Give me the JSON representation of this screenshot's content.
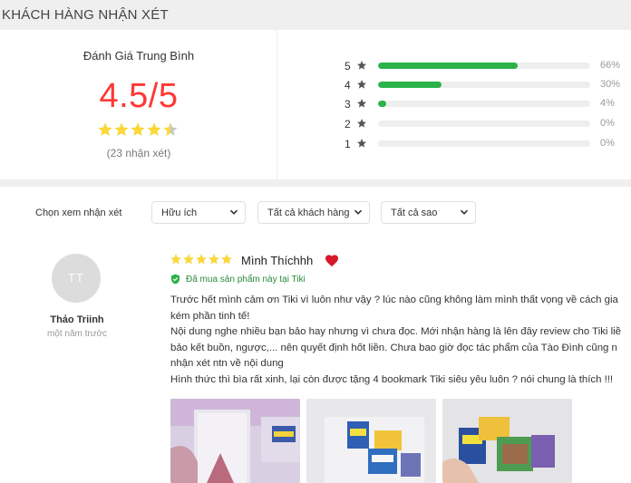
{
  "section_title": "KHÁCH HÀNG NHẬN XÉT",
  "summary": {
    "heading": "Đánh Giá Trung Bình",
    "score": "4.5/5",
    "rating": 4.5,
    "count": "(23 nhận xét)"
  },
  "distribution": [
    {
      "stars": "5",
      "percent_label": "66%",
      "percent": 66
    },
    {
      "stars": "4",
      "percent_label": "30%",
      "percent": 30
    },
    {
      "stars": "3",
      "percent_label": "4%",
      "percent": 4
    },
    {
      "stars": "2",
      "percent_label": "0%",
      "percent": 0
    },
    {
      "stars": "1",
      "percent_label": "0%",
      "percent": 0
    }
  ],
  "filters": {
    "label": "Chọn xem nhận xét",
    "sort": "Hữu ích",
    "customers": "Tất cả khách hàng",
    "stars": "Tất cả sao"
  },
  "review": {
    "avatar_initials": "TT",
    "author": "Thảo Triinh",
    "time": "một năm trước",
    "rating": 5,
    "title": "Mình Thíchhh",
    "verified": "Đã mua sản phẩm này tại Tiki",
    "lines": [
      "Trước hết mình cảm ơn Tiki vì luôn như vậy ? lúc nào cũng không làm mình thất vọng về cách gia",
      "kém phần tinh tế!",
      "Nội dung nghe nhiều bạn bảo hay nhưng vì chưa đọc. Mới nhận hàng là lên đây review cho Tiki liề",
      "bảo kết buồn, ngược,... nên quyết định hốt liền. Chưa bao giờ đọc tác phẩm của Tào Đình cũng n",
      "nhận xét ntn về nội dung",
      "Hình thức thì bìa rất xinh, lại còn được tặng 4 bookmark Tiki siêu yêu luôn ? nói chung là thích !!!"
    ]
  },
  "colors": {
    "accent_red": "#fe3834",
    "star": "#fdd836",
    "bar_fill": "#2bb34a",
    "verified": "#2a8a3a"
  },
  "icons": [
    "star-icon",
    "heart-icon",
    "shield-check-icon",
    "chevron-down-icon"
  ]
}
